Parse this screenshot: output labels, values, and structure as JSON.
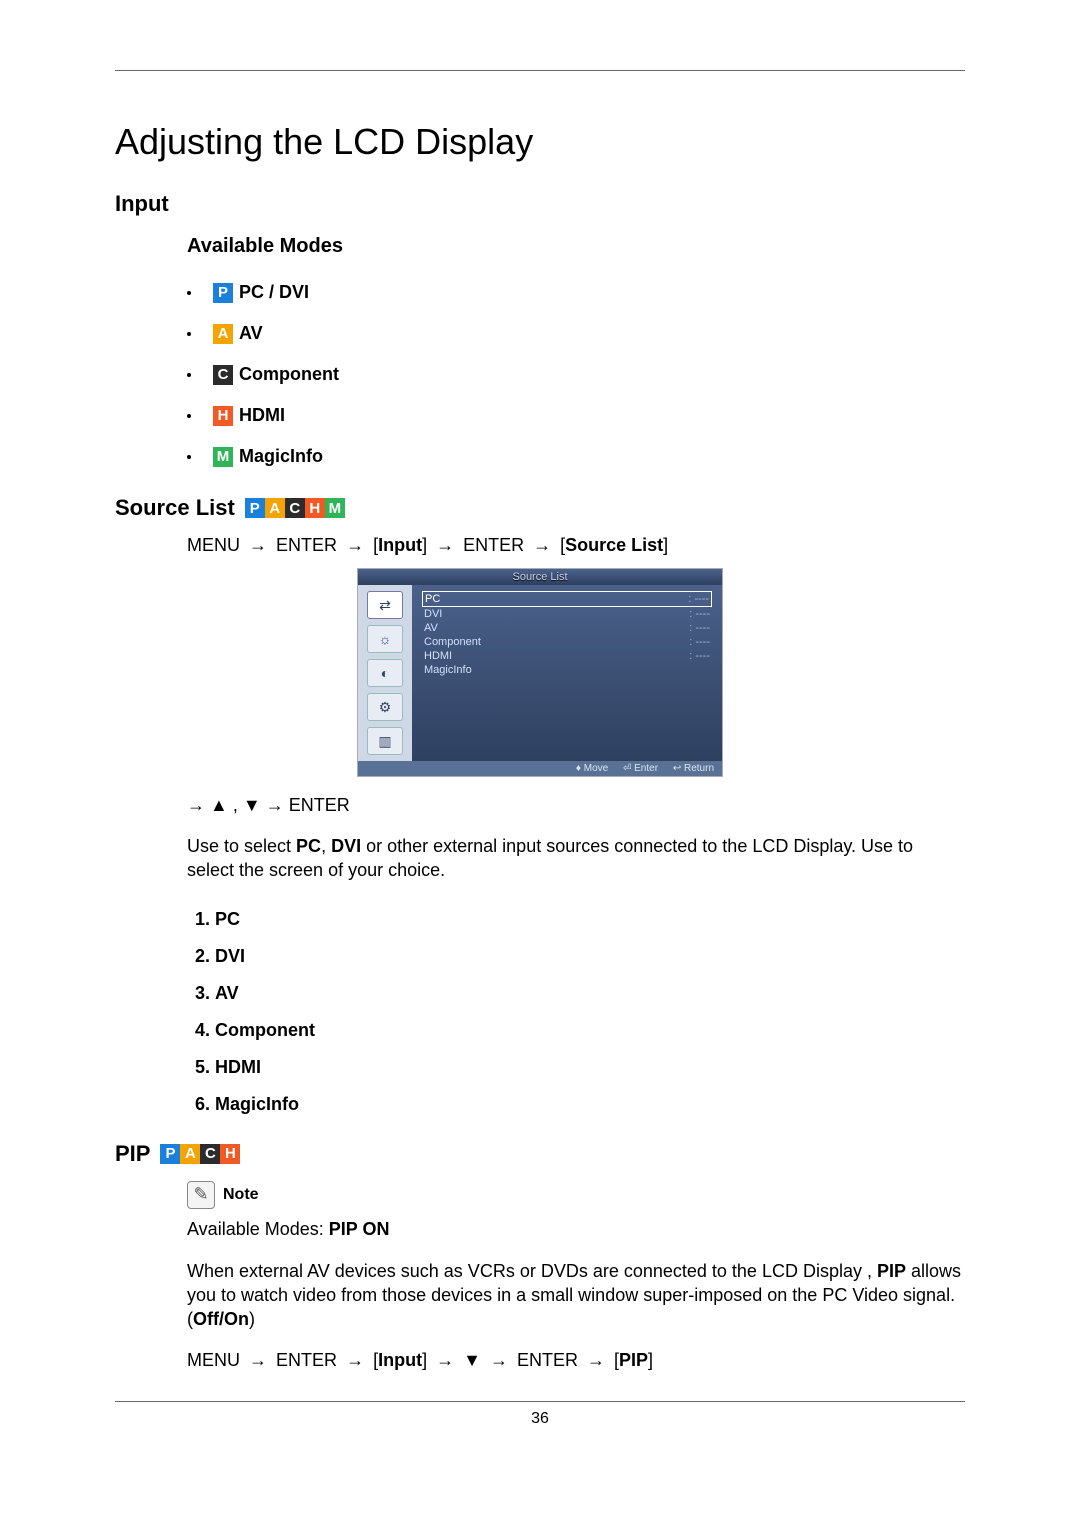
{
  "page_number": "36",
  "title": "Adjusting the LCD Display",
  "section_input": "Input",
  "available_modes_heading": "Available Modes",
  "modes": {
    "pc": {
      "badge": "P",
      "label": "PC / DVI"
    },
    "av": {
      "badge": "A",
      "label": "AV"
    },
    "comp": {
      "badge": "C",
      "label": "Component"
    },
    "hdmi": {
      "badge": "H",
      "label": "HDMI"
    },
    "mi": {
      "badge": "M",
      "label": "MagicInfo"
    }
  },
  "source_list_heading": "Source List",
  "path1": {
    "menu": "MENU",
    "enter1": "ENTER",
    "input": "Input",
    "enter2": "ENTER",
    "src": "Source List",
    "arrow": "→"
  },
  "osd": {
    "title": "Source List",
    "rows": [
      {
        "name": "PC",
        "val": ": ----",
        "sel": true
      },
      {
        "name": "DVI",
        "val": ": ----"
      },
      {
        "name": "AV",
        "val": ": ----"
      },
      {
        "name": "Component",
        "val": ": ----"
      },
      {
        "name": "HDMI",
        "val": ": ----"
      },
      {
        "name": "MagicInfo",
        "val": ""
      }
    ],
    "footer": {
      "move": "♦ Move",
      "enter": "⏎ Enter",
      "ret": "↩ Return"
    }
  },
  "arrows_line": {
    "arrow": "→",
    "up": "▲",
    "comma": " , ",
    "down": "▼",
    "enter": "ENTER"
  },
  "use_para_1": "Use to select ",
  "use_para_pc": "PC",
  "use_para_mid": ", ",
  "use_para_dvi": "DVI",
  "use_para_2": " or other external input sources connected to the LCD Display. Use to select the screen of your choice.",
  "numlist": [
    "PC",
    "DVI",
    "AV",
    "Component",
    "HDMI",
    "MagicInfo"
  ],
  "pip_heading": "PIP",
  "note_label": "Note",
  "pip_modes_line_a": "Available Modes: ",
  "pip_modes_line_b": "PIP ON",
  "pip_para_1": "When external AV devices such as VCRs or DVDs are connected to the LCD Display , ",
  "pip_para_strong": "PIP",
  "pip_para_2": " allows you to watch video from those devices in a small window super-imposed on the PC Video signal. (",
  "pip_para_offon": "Off/On",
  "pip_para_3": ")",
  "path2": {
    "menu": "MENU",
    "enter1": "ENTER",
    "input": "Input",
    "down": "▼",
    "enter2": "ENTER",
    "pip": "PIP",
    "arrow": "→"
  }
}
